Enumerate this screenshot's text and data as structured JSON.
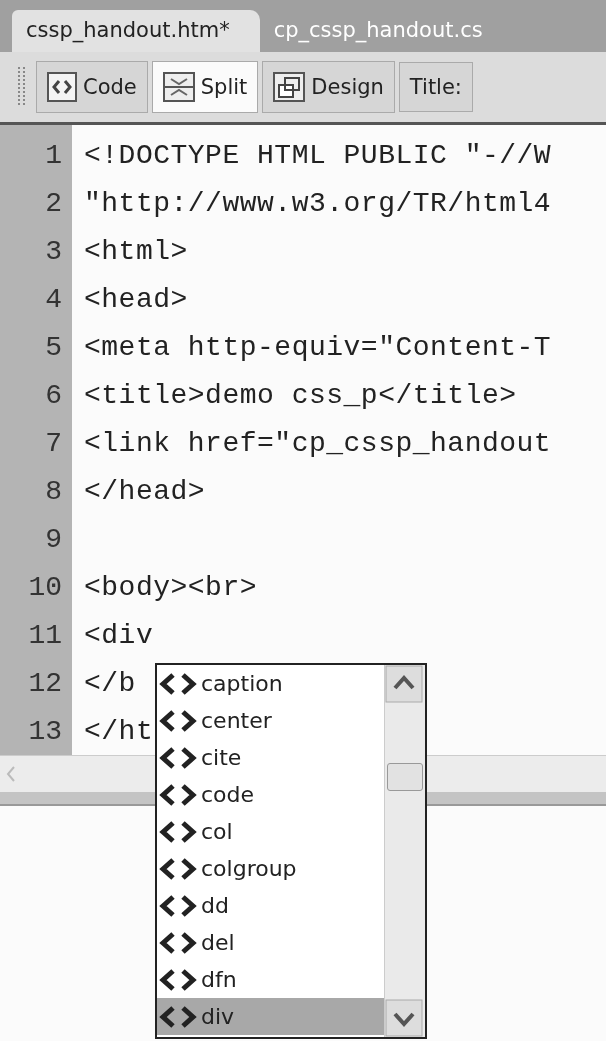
{
  "tabs": [
    {
      "label": "cssp_handout.htm*",
      "selected": true
    },
    {
      "label": "cp_cssp_handout.cs",
      "selected": false
    }
  ],
  "toolbar": {
    "views": [
      {
        "kind": "code",
        "label": "Code",
        "selected": false
      },
      {
        "kind": "split",
        "label": "Split",
        "selected": true
      },
      {
        "kind": "design",
        "label": "Design",
        "selected": false
      }
    ],
    "title_label": "Title:"
  },
  "editor": {
    "lines": [
      {
        "number": "1",
        "text": "<!DOCTYPE HTML PUBLIC \"-//W"
      },
      {
        "number": "2",
        "text": "\"http://www.w3.org/TR/html4"
      },
      {
        "number": "3",
        "text": "<html>"
      },
      {
        "number": "4",
        "text": "<head>"
      },
      {
        "number": "5",
        "text": "<meta http-equiv=\"Content-T"
      },
      {
        "number": "6",
        "text": "<title>demo css_p</title>"
      },
      {
        "number": "7",
        "text": "<link href=\"cp_cssp_handout"
      },
      {
        "number": "8",
        "text": "</head>"
      },
      {
        "number": "9"
      },
      {
        "number": "10",
        "text": "<body><br>"
      },
      {
        "number": "11",
        "text": "<div"
      },
      {
        "number": "12",
        "text": "</b"
      },
      {
        "number": "13",
        "text": "</ht"
      }
    ]
  },
  "autocomplete": {
    "items": [
      {
        "label": "caption",
        "selected": false
      },
      {
        "label": "center",
        "selected": false
      },
      {
        "label": "cite",
        "selected": false
      },
      {
        "label": "code",
        "selected": false
      },
      {
        "label": "col",
        "selected": false
      },
      {
        "label": "colgroup",
        "selected": false
      },
      {
        "label": "dd",
        "selected": false
      },
      {
        "label": "del",
        "selected": false
      },
      {
        "label": "dfn",
        "selected": false
      },
      {
        "label": "div",
        "selected": true
      }
    ]
  }
}
